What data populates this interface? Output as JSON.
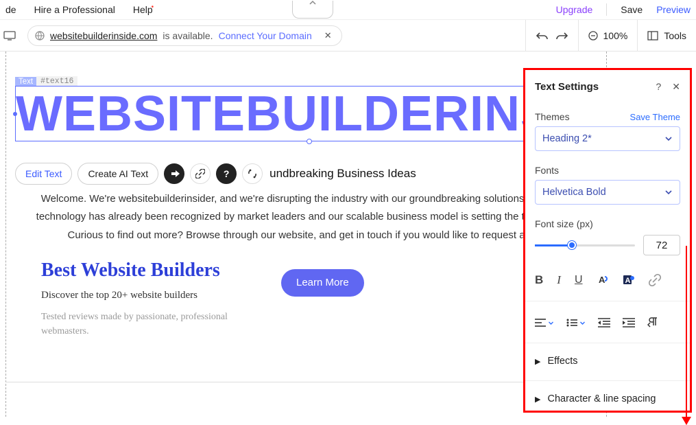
{
  "topbar": {
    "menu_de": "de",
    "menu_hire": "Hire a Professional",
    "menu_help": "Help",
    "upgrade": "Upgrade",
    "save": "Save",
    "preview": "Preview"
  },
  "toolbar2": {
    "domain": "websitebuilderinside.com",
    "avail": "is available.",
    "connect": "Connect Your Domain",
    "zoom": "100%",
    "tools": "Tools"
  },
  "element_tag": {
    "label": "Text",
    "id": "#text16"
  },
  "selected_text": "WEBSITEBUILDERINSIDER",
  "minitb": {
    "edit": "Edit Text",
    "ai": "Create AI Text",
    "tail": "undbreaking Business Ideas"
  },
  "pagecopy": {
    "p1": "Welcome. We're websitebuilderinsider, and we're disrupting the industry with our groundbreaking solutions and busi",
    "p2": "technology has already been recognized by market leaders and our scalable business model is setting the trend for in",
    "p3": "Curious to find out more? Browse through our website, and get in touch if you would like to request a de",
    "card_title": "Best Website Builders",
    "card_sub": "Discover the top 20+ website builders",
    "card_small": "Tested reviews made by passionate, professional webmasters.",
    "learn": "Learn More"
  },
  "panel": {
    "title": "Text Settings",
    "themes_label": "Themes",
    "save_theme": "Save Theme",
    "theme_value": "Heading 2*",
    "fonts_label": "Fonts",
    "font_value": "Helvetica Bold",
    "fontsize_label": "Font size (px)",
    "fontsize_value": "72",
    "effects": "Effects",
    "spacing": "Character & line spacing"
  }
}
